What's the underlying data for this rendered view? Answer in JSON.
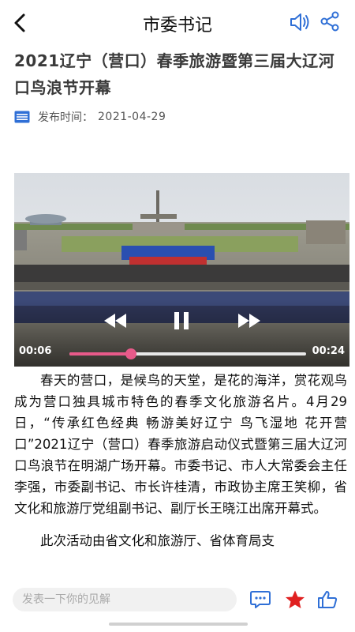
{
  "header": {
    "title": "市委书记",
    "back_icon": "chevron-left-icon",
    "audio_icon": "speaker-icon",
    "share_icon": "share-icon"
  },
  "article": {
    "title": "2021辽宁（营口）春季旅游暨第三届大辽河口鸟浪节开幕",
    "publish_label": "发布时间：",
    "publish_date": "2021-04-29",
    "paragraphs": [
      "春天的营口，是候鸟的天堂，是花的海洋，赏花观鸟成为营口独具城市特色的春季文化旅游名片。4月29日，“传承红色经典 畅游美好辽宁 鸟飞湿地 花开营口”2021辽宁（营口）春季旅游启动仪式暨第三届大辽河口鸟浪节在明湖广场开幕。市委书记、市人大常委会主任李强，市委副书记、市长许桂清，市政协主席王笑柳，省文化和旅游厅党组副书记、副厅长王晓江出席开幕式。",
      "此次活动由省文化和旅游厅、省体育局支"
    ]
  },
  "video": {
    "current_time": "00:06",
    "total_time": "00:24",
    "progress": 0.26
  },
  "bottom_bar": {
    "comment_placeholder": "发表一下你的见解",
    "comments_icon": "comment-icon",
    "favorite_icon": "star-icon",
    "like_icon": "thumbs-up-icon"
  },
  "colors": {
    "accent_pink": "#e85a8a",
    "favorite_red": "#e02020",
    "icon_blue": "#2f6fd6"
  }
}
